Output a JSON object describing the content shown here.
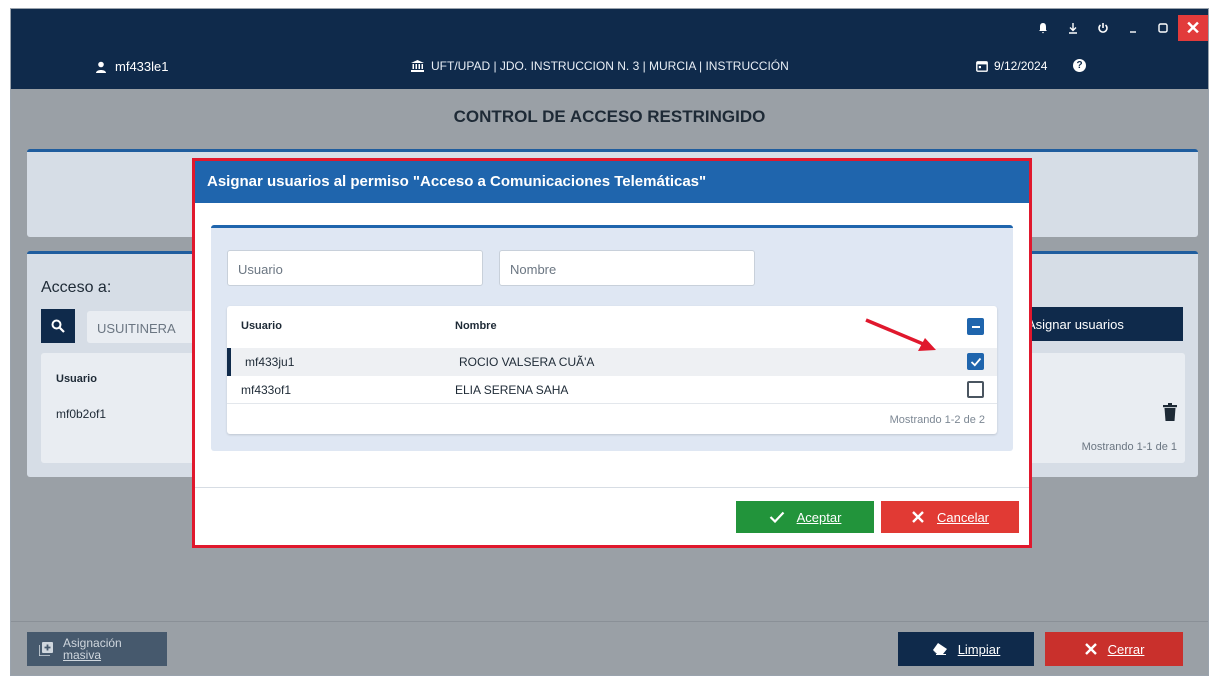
{
  "header": {
    "user": "mf433le1",
    "court": "UFT/UPAD | JDO. INSTRUCCION N. 3 | MURCIA | INSTRUCCIÓN",
    "date": "9/12/2024",
    "help": "?",
    "window_controls": [
      "bell-icon",
      "download-icon",
      "power-icon",
      "minimize-icon",
      "restore-icon",
      "close-icon"
    ]
  },
  "page": {
    "title": "CONTROL DE ACCESO RESTRINGIDO",
    "acceso_label": "Acceso a:",
    "search_value": "USUITINERA",
    "asignar_label": "Asignar usuarios",
    "table": {
      "header": "Usuario",
      "rows": [
        "mf0b2of1"
      ],
      "footer": "Mostrando 1-1 de 1"
    }
  },
  "bottom": {
    "masiva_line1": "Asignación",
    "masiva_line2": "masiva",
    "limpiar": "Limpiar",
    "cerrar": "Cerrar"
  },
  "modal": {
    "title": "Asignar usuarios al permiso \"Acceso a Comunicaciones Telemáticas\"",
    "usuario_placeholder": "Usuario",
    "nombre_placeholder": "Nombre",
    "columns": [
      "Usuario",
      "Nombre"
    ],
    "rows": [
      {
        "usuario": "mf433ju1",
        "nombre": "ROCIO VALSERA CUÃ'A",
        "checked": true
      },
      {
        "usuario": "mf433of1",
        "nombre": "ELIA SERENA SAHA",
        "checked": false
      }
    ],
    "footer": "Mostrando 1-2 de 2",
    "aceptar": "Aceptar",
    "cancelar": "Cancelar"
  },
  "colors": {
    "header_bg": "#0f2a4b",
    "modal_header": "#1f65ad",
    "accept": "#22943b",
    "cancel": "#e13a34",
    "highlight": "#e0182d"
  }
}
